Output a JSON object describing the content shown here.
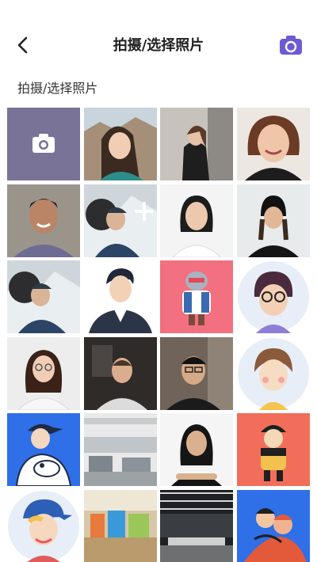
{
  "header": {
    "title": "拍摄/选择照片",
    "accent": "#6c5bd4"
  },
  "section_label": "拍摄/选择照片",
  "photo_tile_color": "#7a7398",
  "photos": [
    {
      "kind": "photo",
      "desc": "woman-long-hair-mountain-background"
    },
    {
      "kind": "photo",
      "desc": "woman-black-top-leaning-on-wall"
    },
    {
      "kind": "photo",
      "desc": "woman-short-hair-smiling"
    },
    {
      "kind": "photo",
      "desc": "man-plaid-shirt-smiling"
    },
    {
      "kind": "photo",
      "desc": "man-with-motorcycle-helmet-add-overlay"
    },
    {
      "kind": "photo",
      "desc": "woman-black-hair-white-background"
    },
    {
      "kind": "photo",
      "desc": "woman-black-beanie"
    },
    {
      "kind": "photo",
      "desc": "man-with-motorcycle-helmet"
    },
    {
      "kind": "illustration",
      "desc": "man-cartoon-dark-hair"
    },
    {
      "kind": "illustration",
      "desc": "robot-character-pink-background"
    },
    {
      "kind": "illustration",
      "desc": "girl-cartoon-glasses-circle"
    },
    {
      "kind": "photo",
      "desc": "woman-glasses-white-shirt"
    },
    {
      "kind": "photo",
      "desc": "man-beard-dark-room"
    },
    {
      "kind": "photo",
      "desc": "man-glasses-black-shirt"
    },
    {
      "kind": "illustration",
      "desc": "boy-cartoon-blush-circle"
    },
    {
      "kind": "illustration",
      "desc": "man-cap-holding-dog-blue-background"
    },
    {
      "kind": "photo",
      "desc": "open-office-space"
    },
    {
      "kind": "photo",
      "desc": "man-long-hair-arms-crossed"
    },
    {
      "kind": "illustration",
      "desc": "character-orange-background"
    },
    {
      "kind": "illustration",
      "desc": "boy-cartoon-blue-cap-circle"
    },
    {
      "kind": "photo",
      "desc": "colorful-office-interior"
    },
    {
      "kind": "photo",
      "desc": "office-hall-ceiling-lights"
    },
    {
      "kind": "illustration",
      "desc": "couple-hug-blue-background"
    }
  ]
}
